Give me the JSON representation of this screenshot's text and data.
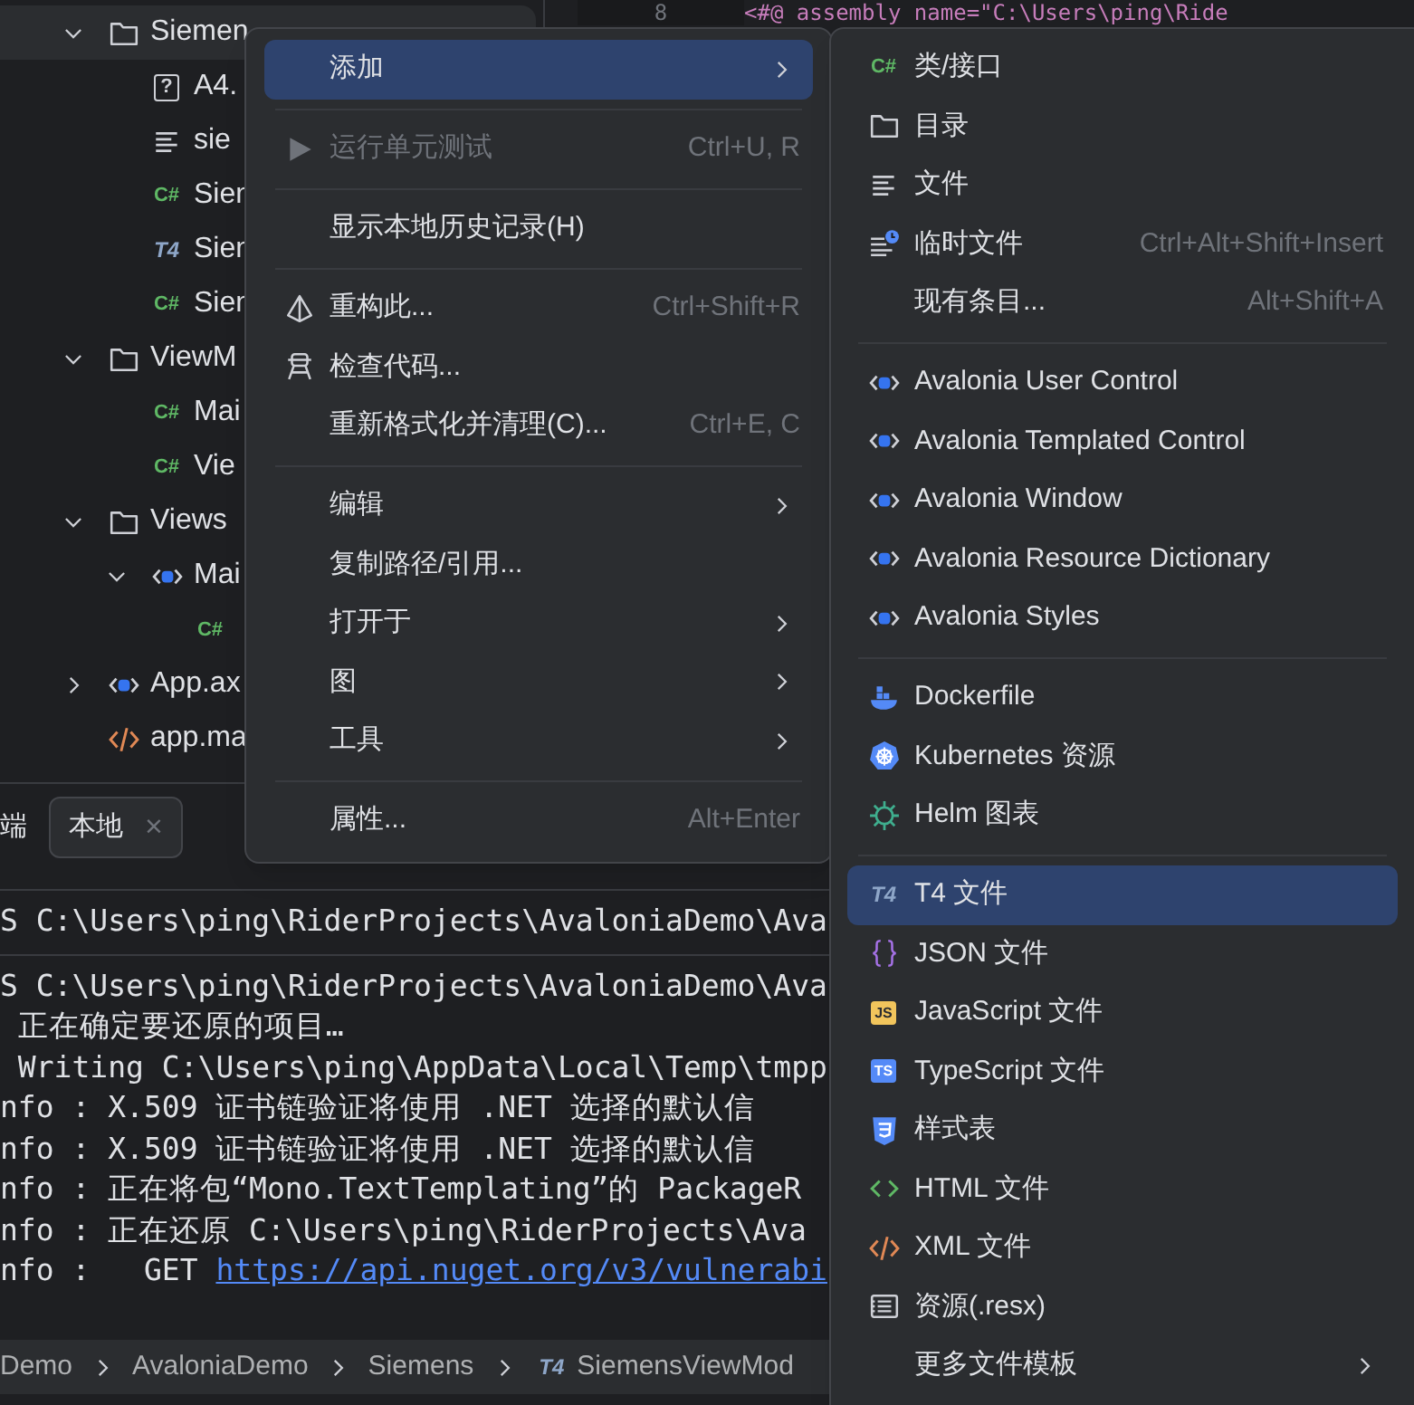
{
  "editor": {
    "line_number": "8",
    "code": "<#@ assembly name=\"C:\\Users\\ping\\Ride"
  },
  "tree": [
    {
      "kind": "folder",
      "label": "Siemen",
      "expanded": true,
      "selected": true,
      "children": [
        {
          "kind": "unknown",
          "badge": "?",
          "label": "A4.",
          "selected": false
        },
        {
          "kind": "text",
          "label": "sie",
          "selected": false
        },
        {
          "kind": "csharp",
          "badge": "C#",
          "label": "Sien",
          "selected": false
        },
        {
          "kind": "t4",
          "badge": "T4",
          "label": "Sien",
          "selected": false
        },
        {
          "kind": "csharp",
          "badge": "C#",
          "label": "Sien",
          "selected": false
        }
      ]
    },
    {
      "kind": "folder",
      "label": "ViewM",
      "expanded": true,
      "selected": false,
      "children": [
        {
          "kind": "csharp",
          "badge": "C#",
          "label": "Mai",
          "selected": false
        },
        {
          "kind": "csharp",
          "badge": "C#",
          "label": "Vie",
          "selected": false
        }
      ]
    },
    {
      "kind": "folder",
      "label": "Views",
      "expanded": true,
      "selected": false,
      "children": [
        {
          "kind": "avalonia",
          "label": "Mai",
          "expanded": true,
          "selected": false,
          "children": [
            {
              "kind": "csharp",
              "badge": "C#",
              "selected": false
            }
          ]
        }
      ]
    },
    {
      "kind": "avalonia",
      "label": "App.ax",
      "expanded": false,
      "selected": false
    },
    {
      "kind": "xml",
      "label": "app.ma",
      "selected": false
    }
  ],
  "terminal": {
    "tabs": [
      {
        "label": "端",
        "selected": false
      },
      {
        "label": "本地",
        "selected": true,
        "close_glyph": "×"
      }
    ],
    "blocks": [
      [
        {
          "text": "S C:\\Users\\ping\\RiderProjects\\AvaloniaDemo\\Ava"
        }
      ],
      [
        {
          "text": "S C:\\Users\\ping\\RiderProjects\\AvaloniaDemo\\Ava"
        },
        {
          "text": " 正在确定要还原的项目…"
        },
        {
          "text": " Writing C:\\Users\\ping\\AppData\\Local\\Temp\\tmpp"
        },
        {
          "text": "nfo : X.509 证书链验证将使用 .NET 选择的默认信"
        },
        {
          "text": "nfo : X.509 证书链验证将使用 .NET 选择的默认信"
        },
        {
          "text": "nfo : 正在将包“Mono.TextTemplating”的 PackageR"
        },
        {
          "text": "nfo : 正在还原 C:\\Users\\ping\\RiderProjects\\Ava"
        },
        {
          "text": "nfo :   GET ",
          "link": "https://api.nuget.org/v3/vulnerabi"
        }
      ]
    ]
  },
  "breadcrumb": [
    {
      "label": "Demo"
    },
    {
      "label": "AvaloniaDemo"
    },
    {
      "label": "Siemens"
    },
    {
      "label": "SiemensViewMod",
      "kind": "t4",
      "badge": "T4"
    }
  ],
  "context_menu": {
    "groups": [
      [
        {
          "label": "添加",
          "has_submenu": true,
          "selected": true,
          "disabled": false
        }
      ],
      [
        {
          "label": "运行单元测试",
          "kind": "play",
          "shortcut": "Ctrl+U, R",
          "has_submenu": false,
          "selected": false,
          "disabled": true
        }
      ],
      [
        {
          "label": "显示本地历史记录(H)",
          "has_submenu": false,
          "selected": false,
          "disabled": false
        }
      ],
      [
        {
          "label": "重构此...",
          "kind": "refactor",
          "shortcut": "Ctrl+Shift+R",
          "has_submenu": false,
          "selected": false,
          "disabled": false
        },
        {
          "label": "检查代码...",
          "kind": "inspect",
          "has_submenu": false,
          "selected": false,
          "disabled": false
        },
        {
          "label": "重新格式化并清理(C)...",
          "shortcut": "Ctrl+E, C",
          "has_submenu": false,
          "selected": false,
          "disabled": false
        }
      ],
      [
        {
          "label": "编辑",
          "has_submenu": true,
          "selected": false,
          "disabled": false
        },
        {
          "label": "复制路径/引用...",
          "has_submenu": false,
          "selected": false,
          "disabled": false
        },
        {
          "label": "打开于",
          "has_submenu": true,
          "selected": false,
          "disabled": false
        },
        {
          "label": "图",
          "has_submenu": true,
          "selected": false,
          "disabled": false
        },
        {
          "label": "工具",
          "has_submenu": true,
          "selected": false,
          "disabled": false
        }
      ],
      [
        {
          "label": "属性...",
          "shortcut": "Alt+Enter",
          "has_submenu": false,
          "selected": false,
          "disabled": false
        }
      ]
    ]
  },
  "submenu": {
    "groups": [
      [
        {
          "label": "类/接口",
          "kind": "csharp",
          "badge": "C#",
          "has_submenu": false,
          "selected": false
        },
        {
          "label": "目录",
          "kind": "folder",
          "has_submenu": false,
          "selected": false
        },
        {
          "label": "文件",
          "kind": "text",
          "has_submenu": false,
          "selected": false
        },
        {
          "label": "临时文件",
          "kind": "scratch",
          "shortcut": "Ctrl+Alt+Shift+Insert",
          "has_submenu": false,
          "selected": false
        },
        {
          "label": "现有条目...",
          "shortcut": "Alt+Shift+A",
          "has_submenu": false,
          "selected": false
        }
      ],
      [
        {
          "label": "Avalonia User Control",
          "kind": "avalonia",
          "has_submenu": false,
          "selected": false
        },
        {
          "label": "Avalonia Templated Control",
          "kind": "avalonia",
          "has_submenu": false,
          "selected": false
        },
        {
          "label": "Avalonia Window",
          "kind": "avalonia",
          "has_submenu": false,
          "selected": false
        },
        {
          "label": "Avalonia Resource Dictionary",
          "kind": "avalonia",
          "has_submenu": false,
          "selected": false
        },
        {
          "label": "Avalonia Styles",
          "kind": "avalonia",
          "has_submenu": false,
          "selected": false
        }
      ],
      [
        {
          "label": "Dockerfile",
          "kind": "docker",
          "has_submenu": false,
          "selected": false
        },
        {
          "label": "Kubernetes 资源",
          "kind": "kubernetes",
          "has_submenu": false,
          "selected": false
        },
        {
          "label": "Helm 图表",
          "kind": "helm",
          "has_submenu": false,
          "selected": false
        }
      ],
      [
        {
          "label": "T4 文件",
          "kind": "t4",
          "badge": "T4",
          "has_submenu": false,
          "selected": true
        },
        {
          "label": "JSON 文件",
          "kind": "json",
          "has_submenu": false,
          "selected": false
        },
        {
          "label": "JavaScript 文件",
          "kind": "js",
          "badge": "JS",
          "has_submenu": false,
          "selected": false
        },
        {
          "label": "TypeScript 文件",
          "kind": "ts",
          "badge": "TS",
          "has_submenu": false,
          "selected": false
        },
        {
          "label": "样式表",
          "kind": "css",
          "has_submenu": false,
          "selected": false
        },
        {
          "label": "HTML 文件",
          "kind": "html",
          "has_submenu": false,
          "selected": false
        },
        {
          "label": "XML 文件",
          "kind": "xml",
          "has_submenu": false,
          "selected": false
        },
        {
          "label": "资源(.resx)",
          "kind": "resx",
          "has_submenu": false,
          "selected": false
        },
        {
          "label": "更多文件模板",
          "has_submenu": true,
          "selected": false
        }
      ]
    ]
  }
}
